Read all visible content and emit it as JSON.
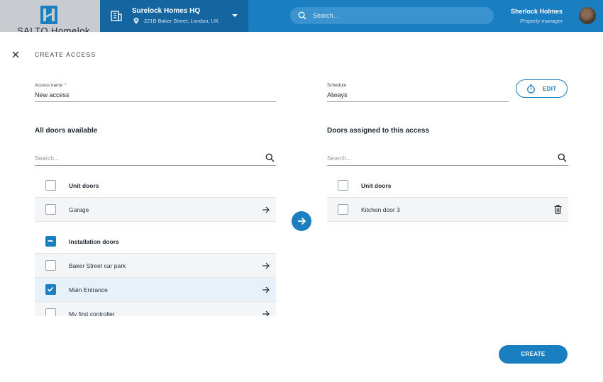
{
  "header": {
    "brand_name": "SALTO Homelok",
    "site_name": "Surelock Homes HQ",
    "site_address": "221B Baker Street, London, UK",
    "search_placeholder": "Search...",
    "user_name": "Sherlock Holmes",
    "user_role": "Property manager"
  },
  "page": {
    "title": "CREATE ACCESS"
  },
  "form": {
    "access_name_label": "Access name",
    "access_name_required": "*",
    "access_name_value": "New access",
    "schedule_label": "Schedule",
    "schedule_value": "Always",
    "edit_label": "EDIT"
  },
  "available": {
    "title": "All doors available",
    "search_placeholder": "Search...",
    "groups": [
      {
        "label": "Unit doors",
        "state": "unchecked",
        "items": [
          {
            "label": "Garage",
            "checked": false
          }
        ]
      },
      {
        "label": "Installation doors",
        "state": "partial",
        "items": [
          {
            "label": "Baker Street car park",
            "checked": false
          },
          {
            "label": "Main Entrance",
            "checked": true
          },
          {
            "label": "My first controller",
            "checked": false
          }
        ]
      }
    ]
  },
  "assigned": {
    "title": "Doors assigned to this access",
    "search_placeholder": "Search...",
    "groups": [
      {
        "label": "Unit doors",
        "state": "unchecked",
        "items": [
          {
            "label": "Kitchen door 3",
            "checked": false
          }
        ]
      }
    ]
  },
  "actions": {
    "create_label": "CREATE"
  },
  "colors": {
    "primary": "#1a7fc1",
    "topbar_site": "#1465a0",
    "brand_bg": "#c8ccd0",
    "selected_row": "#e6f1fa"
  }
}
